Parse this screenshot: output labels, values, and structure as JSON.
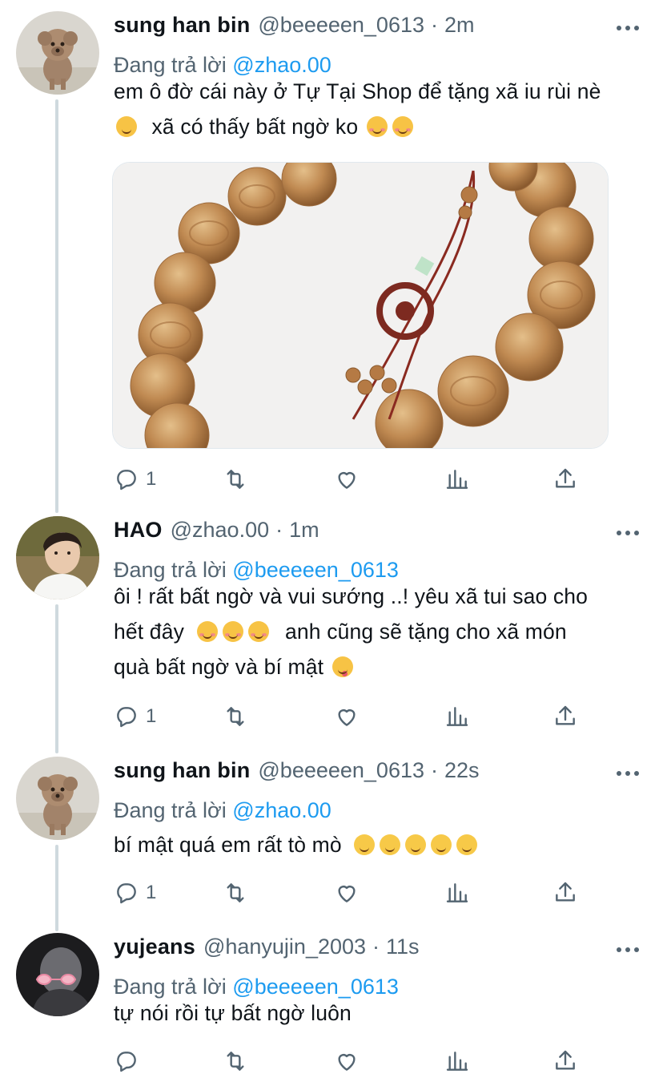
{
  "tweets": [
    {
      "name": "sung han bin",
      "handle": "@beeeeen_0613",
      "dot": "·",
      "time": "2m",
      "replying_label": "Đang trả lời",
      "replying_to": "@zhao.00",
      "avatar": "poodle-avatar",
      "lines": [
        "em ô đờ cái này ở Tự Tại Shop để tặng xã iu rùi nè",
        "xã có thấy bất ngờ ko"
      ],
      "reply_count": "1",
      "media": "wooden-bead-bracelet-photo"
    },
    {
      "name": "HAO",
      "handle": "@zhao.00",
      "dot": "·",
      "time": "1m",
      "replying_label": "Đang trả lời",
      "replying_to": "@beeeeen_0613",
      "avatar": "boy-portrait-avatar",
      "lines": [
        "ôi ! rất bất ngờ và vui sướng ..! yêu xã tui sao cho",
        "hết đây",
        "anh cũng sẽ tặng cho xã món",
        "quà bất ngờ và bí mật"
      ],
      "reply_count": "1"
    },
    {
      "name": "sung han bin",
      "handle": "@beeeeen_0613",
      "dot": "·",
      "time": "22s",
      "replying_label": "Đang trả lời",
      "replying_to": "@zhao.00",
      "avatar": "poodle-avatar",
      "lines": [
        "bí mật quá em rất tò mò"
      ],
      "reply_count": "1"
    },
    {
      "name": "yujeans",
      "handle": "@hanyujin_2003",
      "dot": "·",
      "time": "11s",
      "replying_label": "Đang trả lời",
      "replying_to": "@beeeeen_0613",
      "avatar": "heart-glasses-avatar",
      "lines": [
        "tự nói rồi tự bất ngờ luôn"
      ],
      "reply_count": ""
    }
  ],
  "icons": {
    "reply": "reply-icon",
    "retweet": "retweet-icon",
    "like": "like-icon",
    "views": "views-icon",
    "share": "share-icon",
    "more": "more-icon"
  },
  "colors": {
    "name": "#0f1419",
    "meta": "#536471",
    "mention": "#1d9bf0",
    "thread_line": "#cfd9de"
  }
}
